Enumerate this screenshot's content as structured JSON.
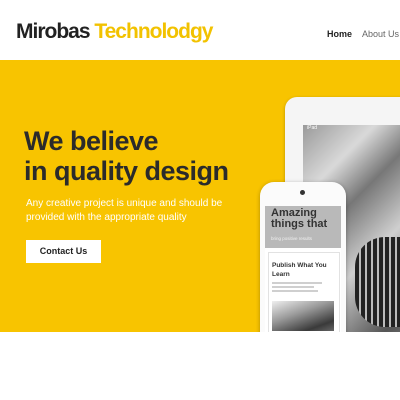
{
  "brand": {
    "word1": "Mirobas",
    "word2": "Technolodgy",
    "accent": "#f2c200",
    "dark": "#222222"
  },
  "nav": {
    "home": "Home",
    "about": "About Us"
  },
  "hero": {
    "background": "#f8c400",
    "headline_line1": "We believe",
    "headline_line2": "in quality design",
    "subtext": "Any creative project is unique and should be provided with the appropriate quality",
    "cta_label": "Contact Us"
  },
  "devices": {
    "tablet_status": "iPad",
    "phone_hero_title": "Amazing things that",
    "phone_hero_sub": "bring positive results",
    "phone_card_title": "Publish What You Learn"
  }
}
